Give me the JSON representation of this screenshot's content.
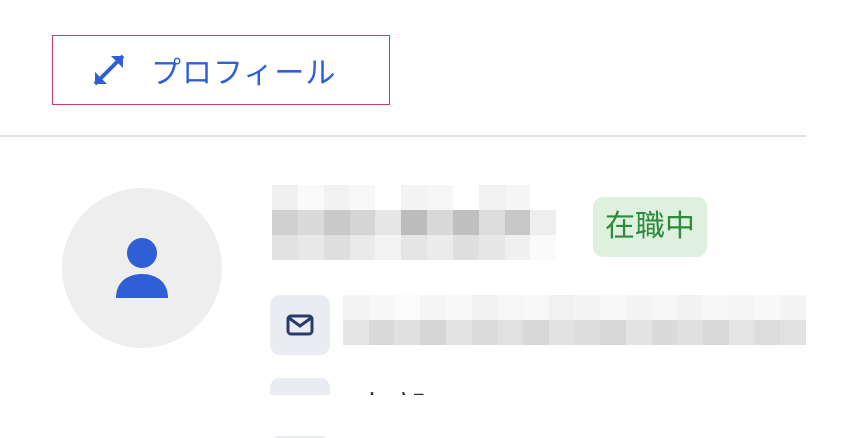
{
  "header": {
    "profile_label": "プロフィール",
    "expand_icon": "expand-diagonal-icon"
  },
  "user": {
    "avatar_icon": "person-icon",
    "status_badge": "在職中",
    "email_icon": "mail-icon",
    "department_icon": "building-icon",
    "department_partial": "本部 ..."
  },
  "colors": {
    "accent": "#2f5fd6",
    "focus_border": "#d23a6e",
    "badge_bg": "#dff0df",
    "badge_text": "#2e8a3c"
  }
}
